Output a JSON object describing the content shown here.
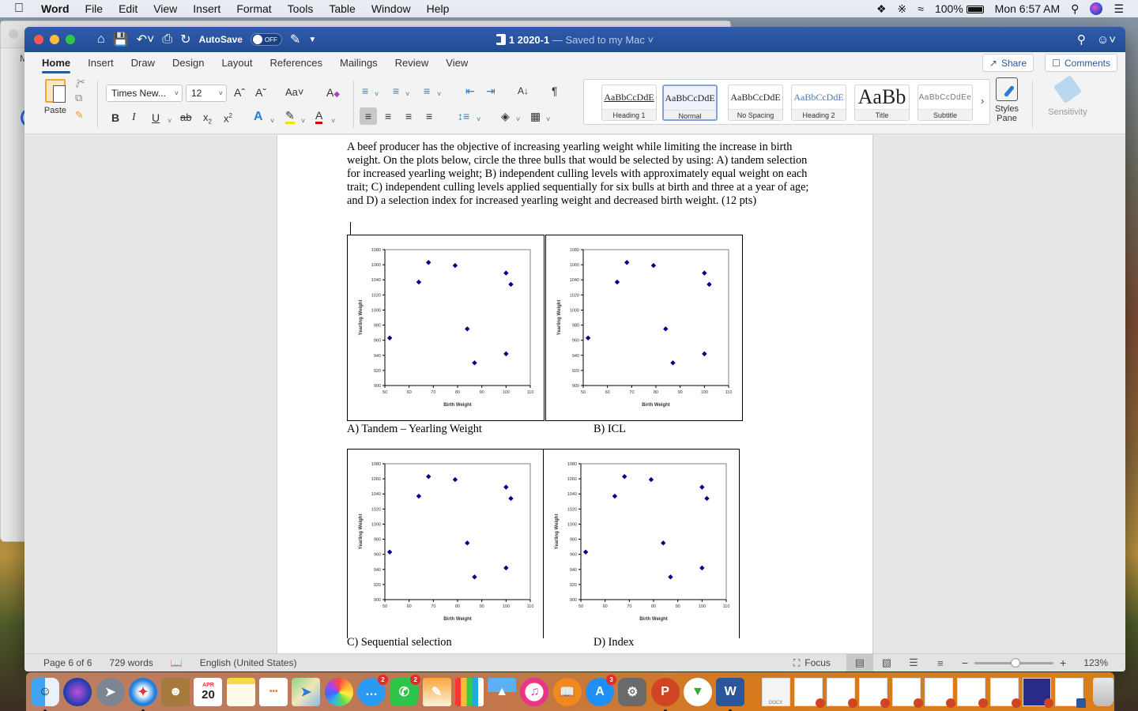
{
  "menubar": {
    "app_name": "Word",
    "items": [
      "File",
      "Edit",
      "View",
      "Insert",
      "Format",
      "Tools",
      "Table",
      "Window",
      "Help"
    ],
    "battery": "100%",
    "clock": "Mon 6:57 AM"
  },
  "window": {
    "autosave_label": "AutoSave",
    "autosave_state": "OFF",
    "doc_name": "1 2020-1",
    "save_status": "— Saved to my Mac"
  },
  "ribbon": {
    "tabs": [
      "Home",
      "Insert",
      "Draw",
      "Design",
      "Layout",
      "References",
      "Mailings",
      "Review",
      "View"
    ],
    "active_tab": "Home",
    "share_label": "Share",
    "comments_label": "Comments",
    "paste_label": "Paste",
    "font_name": "Times New...",
    "font_size": "12",
    "styles": [
      {
        "preview": "AaBbCcDdE",
        "label": "Heading 1"
      },
      {
        "preview": "AaBbCcDdE",
        "label": "Normal"
      },
      {
        "preview": "AaBbCcDdE",
        "label": "No Spacing"
      },
      {
        "preview": "AaBbCcDdE",
        "label": "Heading 2"
      },
      {
        "preview": "AaBb",
        "label": "Title"
      },
      {
        "preview": "AaBbCcDdEe",
        "label": "Subtitle"
      }
    ],
    "selected_style": "Normal",
    "styles_pane_label": "Styles Pane",
    "sensitivity_label": "Sensitivity"
  },
  "document": {
    "question": "A beef producer has the objective of increasing yearling weight while limiting the increase in birth weight.  On the plots below, circle the three bulls that would be selected by using: A) tandem selection for increased yearling weight; B) independent culling levels with approximately equal weight on each trait; C) independent culling levels applied sequentially for six bulls at birth and three at a year of age; and D) a selection index for increased yearling weight and decreased birth weight. (12 pts)",
    "captions": [
      "A) Tandem – Yearling Weight",
      "B) ICL",
      "C) Sequential selection",
      "D) Index"
    ]
  },
  "chart_data": [
    {
      "type": "scatter",
      "panel": "A) Tandem – Yearling Weight",
      "xlabel": "Birth Weight",
      "ylabel": "Yearling Weight",
      "xlim": [
        50,
        110
      ],
      "ylim": [
        900,
        1080
      ],
      "xticks": [
        "50",
        "60",
        "70",
        "80",
        "90",
        "100",
        "110"
      ],
      "yticks": [
        "900",
        "920",
        "940",
        "960",
        "980",
        "1000",
        "1020",
        "1040",
        "1060",
        "1080"
      ],
      "marker_color": "#00008b",
      "points": [
        [
          52,
          963
        ],
        [
          64,
          1037
        ],
        [
          68,
          1063
        ],
        [
          79,
          1059
        ],
        [
          84,
          975
        ],
        [
          87,
          930
        ],
        [
          100,
          1049
        ],
        [
          102,
          1034
        ],
        [
          100,
          942
        ]
      ]
    },
    {
      "type": "scatter",
      "panel": "B) ICL",
      "xlabel": "Birth Weight",
      "ylabel": "Yearling Weight",
      "xlim": [
        50,
        110
      ],
      "ylim": [
        900,
        1080
      ],
      "xticks": [
        "50",
        "60",
        "70",
        "80",
        "90",
        "100",
        "110"
      ],
      "yticks": [
        "900",
        "920",
        "940",
        "960",
        "980",
        "1000",
        "1020",
        "1040",
        "1060",
        "1080"
      ],
      "marker_color": "#00008b",
      "points": [
        [
          52,
          963
        ],
        [
          64,
          1037
        ],
        [
          68,
          1063
        ],
        [
          79,
          1059
        ],
        [
          84,
          975
        ],
        [
          87,
          930
        ],
        [
          100,
          1049
        ],
        [
          102,
          1034
        ],
        [
          100,
          942
        ]
      ]
    },
    {
      "type": "scatter",
      "panel": "C) Sequential selection",
      "xlabel": "Birth Weight",
      "ylabel": "Yearling Weight",
      "xlim": [
        50,
        110
      ],
      "ylim": [
        900,
        1080
      ],
      "xticks": [
        "50",
        "60",
        "70",
        "80",
        "90",
        "100",
        "110"
      ],
      "yticks": [
        "900",
        "920",
        "940",
        "960",
        "980",
        "1000",
        "1020",
        "1040",
        "1060",
        "1080"
      ],
      "marker_color": "#00008b",
      "points": [
        [
          52,
          963
        ],
        [
          64,
          1037
        ],
        [
          68,
          1063
        ],
        [
          79,
          1059
        ],
        [
          84,
          975
        ],
        [
          87,
          930
        ],
        [
          100,
          1049
        ],
        [
          102,
          1034
        ],
        [
          100,
          942
        ]
      ]
    },
    {
      "type": "scatter",
      "panel": "D) Index",
      "xlabel": "Birth Weight",
      "ylabel": "Yearling Weight",
      "xlim": [
        50,
        110
      ],
      "ylim": [
        900,
        1080
      ],
      "xticks": [
        "50",
        "60",
        "70",
        "80",
        "90",
        "100",
        "110"
      ],
      "yticks": [
        "900",
        "920",
        "940",
        "960",
        "980",
        "1000",
        "1020",
        "1040",
        "1060",
        "1080"
      ],
      "marker_color": "#00008b",
      "points": [
        [
          52,
          963
        ],
        [
          64,
          1037
        ],
        [
          68,
          1063
        ],
        [
          79,
          1059
        ],
        [
          84,
          975
        ],
        [
          87,
          930
        ],
        [
          100,
          1049
        ],
        [
          102,
          1034
        ],
        [
          100,
          942
        ]
      ]
    }
  ],
  "statusbar": {
    "page": "Page 6 of 6",
    "words": "729 words",
    "language": "English (United States)",
    "focus_label": "Focus",
    "zoom": "123%",
    "zoom_slider_fraction": 0.52
  },
  "dock": {
    "apps": [
      {
        "name": "Finder",
        "icon": "finder-icon",
        "running": true
      },
      {
        "name": "Siri",
        "icon": "siri-icon"
      },
      {
        "name": "Launchpad",
        "icon": "launchpad-icon"
      },
      {
        "name": "Safari",
        "icon": "safari-icon",
        "running": true
      },
      {
        "name": "Contacts",
        "icon": "contacts-icon"
      },
      {
        "name": "Calendar",
        "icon": "calendar-icon",
        "month": "APR",
        "day": "20"
      },
      {
        "name": "Notes",
        "icon": "notes-icon"
      },
      {
        "name": "Reminders",
        "icon": "reminders-icon"
      },
      {
        "name": "Maps",
        "icon": "maps-icon"
      },
      {
        "name": "Photos",
        "icon": "photos-icon"
      },
      {
        "name": "Messages",
        "icon": "messages-icon",
        "badge": "2"
      },
      {
        "name": "FaceTime",
        "icon": "facetime-icon",
        "badge": "2"
      },
      {
        "name": "Pages",
        "icon": "pages-icon"
      },
      {
        "name": "Numbers",
        "icon": "numbers-icon"
      },
      {
        "name": "Keynote",
        "icon": "keynote-icon"
      },
      {
        "name": "iTunes",
        "icon": "itunes-icon"
      },
      {
        "name": "Books",
        "icon": "books-icon"
      },
      {
        "name": "App Store",
        "icon": "app-store-icon",
        "badge": "3"
      },
      {
        "name": "System Preferences",
        "icon": "system-preferences-icon"
      },
      {
        "name": "PowerPoint",
        "icon": "powerpoint-icon",
        "running": true
      },
      {
        "name": "Microsoft AutoUpdate",
        "icon": "autoupdate-icon"
      },
      {
        "name": "Word",
        "icon": "word-icon",
        "running": true
      }
    ],
    "recent_docs": [
      "docx",
      "pptx",
      "pptx",
      "pptx",
      "pptx",
      "pptx",
      "pptx",
      "pptx",
      "pptx",
      "docx"
    ],
    "doc_label": "DOCX"
  }
}
